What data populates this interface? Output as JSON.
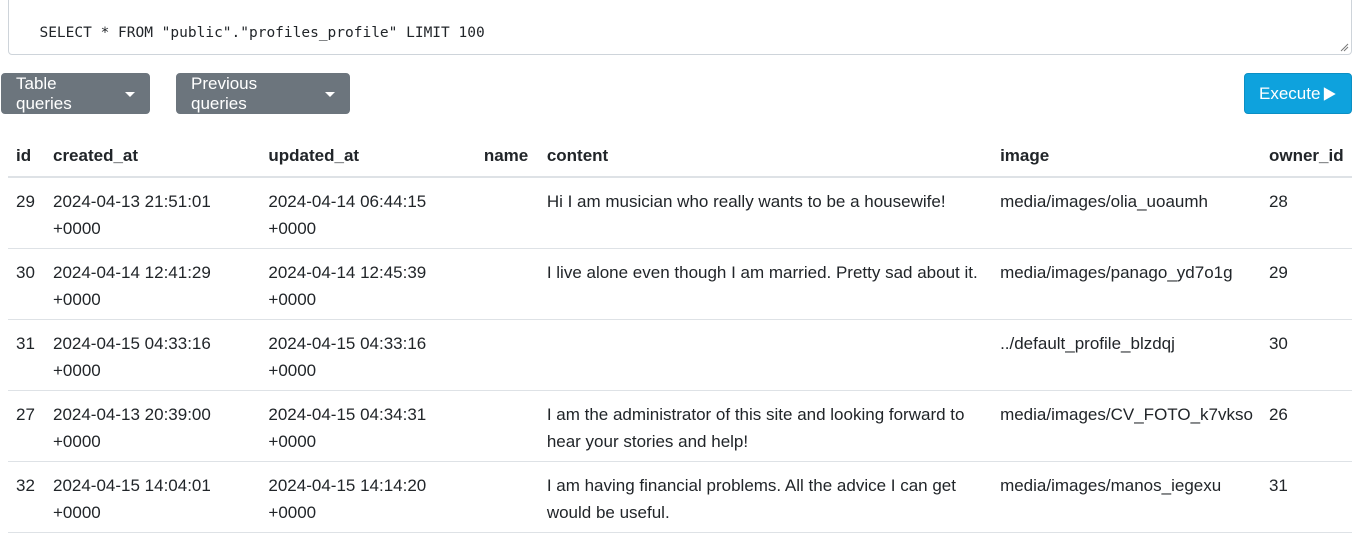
{
  "query": {
    "text": "SELECT * FROM \"public\".\"profiles_profile\" LIMIT 100"
  },
  "toolbar": {
    "table_queries_label": "Table queries",
    "previous_queries_label": "Previous queries",
    "execute_label": "Execute"
  },
  "colors": {
    "secondary": "#6c757d",
    "primary": "#0ea2dd"
  },
  "table": {
    "columns": [
      "id",
      "created_at",
      "updated_at",
      "name",
      "content",
      "image",
      "owner_id"
    ],
    "rows": [
      {
        "id": "29",
        "created_at": "2024-04-13 21:51:01\n+0000",
        "updated_at": "2024-04-14 06:44:15\n+0000",
        "name": "",
        "content": "Hi I am musician who really wants to be a housewife!",
        "image": "media/images/olia_uoaumh",
        "owner_id": "28"
      },
      {
        "id": "30",
        "created_at": "2024-04-14 12:41:29\n+0000",
        "updated_at": "2024-04-14 12:45:39\n+0000",
        "name": "",
        "content": "I live alone even though I am married. Pretty sad about it.",
        "image": "media/images/panago_yd7o1g",
        "owner_id": "29"
      },
      {
        "id": "31",
        "created_at": "2024-04-15 04:33:16\n+0000",
        "updated_at": "2024-04-15 04:33:16\n+0000",
        "name": "",
        "content": "",
        "image": "../default_profile_blzdqj",
        "owner_id": "30"
      },
      {
        "id": "27",
        "created_at": "2024-04-13 20:39:00\n+0000",
        "updated_at": "2024-04-15 04:34:31\n+0000",
        "name": "",
        "content": "I am the administrator of this site and looking forward to hear your stories and help!",
        "image": "media/images/CV_FOTO_k7vkso",
        "owner_id": "26"
      },
      {
        "id": "32",
        "created_at": "2024-04-15 14:04:01\n+0000",
        "updated_at": "2024-04-15 14:14:20\n+0000",
        "name": "",
        "content": "I am having financial problems. All the advice I can get would be useful.",
        "image": "media/images/manos_iegexu",
        "owner_id": "31"
      }
    ]
  }
}
